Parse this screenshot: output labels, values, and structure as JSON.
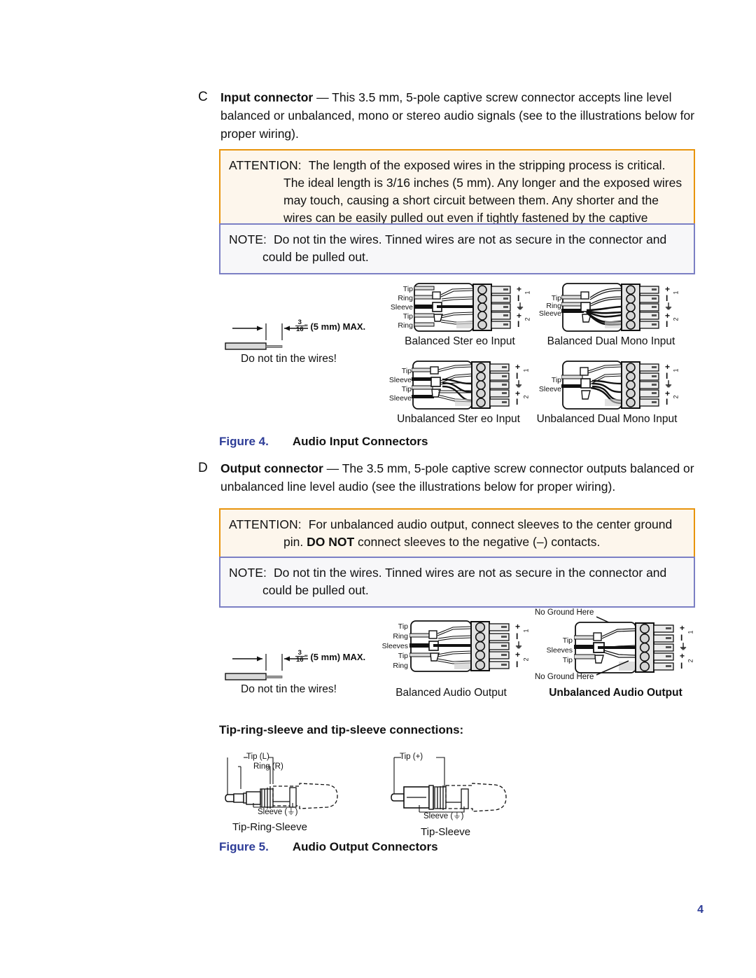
{
  "document": {
    "page_number": "4"
  },
  "items": [
    {
      "letter": "C",
      "title": "Input connector",
      "dash": " — ",
      "text": "This 3.5 mm, 5-pole captive screw connector accepts line level balanced or unbalanced, mono or stereo audio signals (see to the illustrations below for proper wiring)."
    },
    {
      "letter": "D",
      "title": "Output connector",
      "dash": " — ",
      "text": "The 3.5 mm, 5-pole captive screw connector outputs balanced or unbalanced line level audio (see the illustrations below for proper wiring)."
    }
  ],
  "callouts": {
    "attention_1": {
      "label": "ATTENTION:",
      "text": "The length of the exposed wires in the stripping process is critical. The ideal length is 3/16 inches (5 mm). Any longer and the exposed wires may touch, causing a short circuit between them. Any shorter and the wires can be easily pulled out even if tightly fastened by the captive screws.",
      "border_color": "#e8940c",
      "fill_color": "#fdf6ec"
    },
    "note_1": {
      "label": "NOTE:",
      "text": "Do not tin the wires. Tinned wires are not as secure in the connector and could be pulled out.",
      "border_color": "#7b7fc4",
      "fill_color": "#f7f7f9"
    },
    "attention_2": {
      "label": "ATTENTION:",
      "text_part1": "For unbalanced audio output, connect sleeves to the center ground pin. ",
      "bold": "DO NOT",
      "text_part2": " connect sleeves to the negative (–) contacts.",
      "border_color": "#e8940c",
      "fill_color": "#fdf6ec"
    },
    "note_2": {
      "label": "NOTE:",
      "text": "Do not tin the wires. Tinned wires are not as secure in the connector and could be pulled out.",
      "border_color": "#7b7fc4",
      "fill_color": "#f7f7f9"
    }
  },
  "strip_gauge_1": {
    "fraction_numerator": "3",
    "fraction_denominator": "16",
    "unit_mark": "\"",
    "measure": "(5 mm) MAX.",
    "caption": "Do not tin the wires!"
  },
  "strip_gauge_2": {
    "fraction_numerator": "3",
    "fraction_denominator": "16",
    "unit_mark": "\"",
    "measure": "(5 mm) MAX.",
    "caption": "Do not tin the wires!"
  },
  "figure4": {
    "number": "Figure 4.",
    "title": "Audio Input Connectors",
    "number_color": "#2d3c97",
    "diagrams": [
      {
        "caption": "Balanced Ster eo Input",
        "wire_labels": [
          "Tip",
          "Ring",
          "Sleeve",
          "Tip",
          "Ring"
        ],
        "pin_marks": [
          "+",
          "I",
          "GND",
          "+",
          "I"
        ],
        "channels": [
          "1",
          "2"
        ]
      },
      {
        "caption": "Balanced Dual Mono Input",
        "wire_labels": [
          "Tip",
          "Ring",
          "Sleeve"
        ],
        "pin_marks": [
          "+",
          "I",
          "GND",
          "+",
          "I"
        ],
        "channels": [
          "1",
          "2"
        ]
      },
      {
        "caption": "Unbalanced Ster eo Input",
        "wire_labels": [
          "Tip",
          "Sleeve",
          "Tip",
          "Sleeve"
        ],
        "pin_marks": [
          "+",
          "I",
          "GND",
          "+",
          "I"
        ],
        "channels": [
          "1",
          "2"
        ]
      },
      {
        "caption": "Unbalanced Dual Mono Input",
        "wire_labels": [
          "Tip",
          "Sleeve"
        ],
        "pin_marks": [
          "+",
          "I",
          "GND",
          "+",
          "I"
        ],
        "channels": [
          "1",
          "2"
        ]
      }
    ]
  },
  "figure5": {
    "number": "Figure 5.",
    "title": "Audio Output Connectors",
    "number_color": "#2d3c97",
    "subhead": "Tip-ring-sleeve and tip-sleeve connections:",
    "diagrams": [
      {
        "caption": "Balanced Audio Output",
        "caption_bold": false,
        "wire_labels": [
          "Tip",
          "Ring",
          "Sleeves",
          "Tip",
          "Ring"
        ],
        "pin_marks": [
          "+",
          "I",
          "GND",
          "+",
          "I"
        ],
        "channels": [
          "1",
          "2"
        ]
      },
      {
        "caption": "Unbalanced Audio Output",
        "caption_bold": true,
        "wire_labels": [
          "Tip",
          "Sleeves",
          "Tip"
        ],
        "pin_marks": [
          "+",
          "I",
          "GND",
          "+",
          "I"
        ],
        "channels": [
          "1",
          "2"
        ],
        "annotation_top": "No Ground Here",
        "annotation_bottom": "No Ground Here"
      }
    ],
    "plugs": [
      {
        "caption": "Tip-Ring-Sleeve",
        "labels": [
          "Tip (L)",
          "Ring (R)",
          "Sleeve (⏚)"
        ]
      },
      {
        "caption": "Tip-Sleeve",
        "labels": [
          "Tip (+)",
          "Sleeve (⏚)"
        ]
      }
    ]
  }
}
